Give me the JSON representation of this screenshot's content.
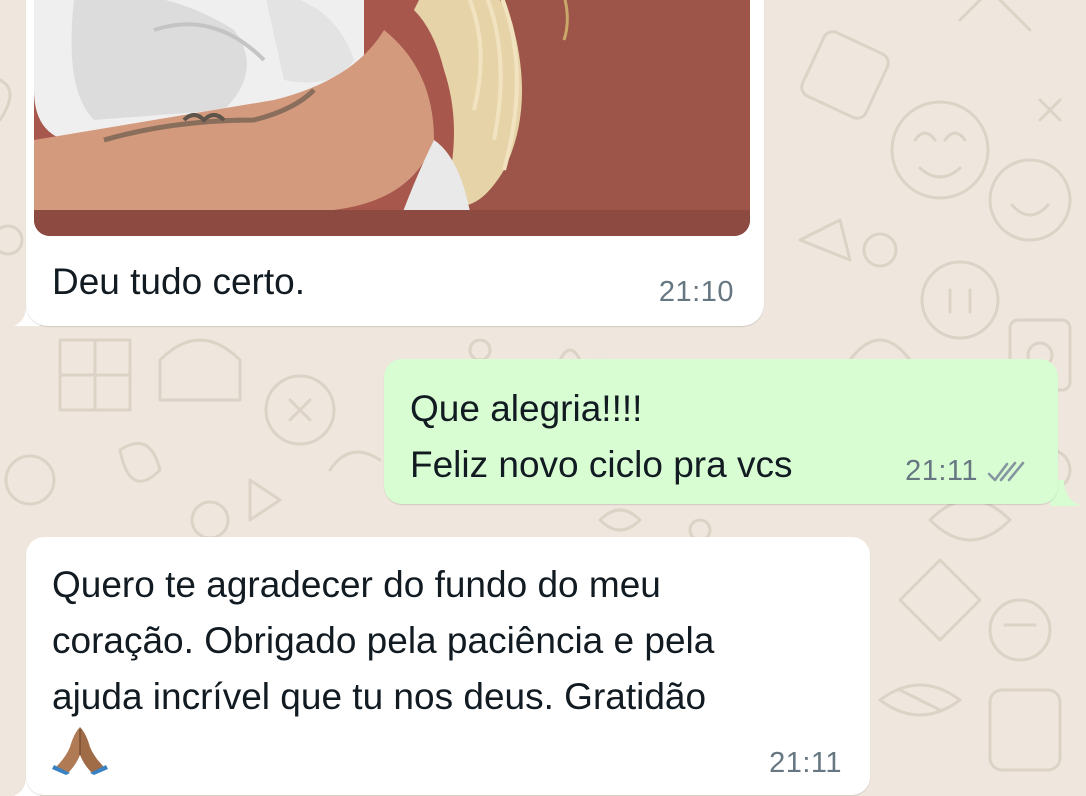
{
  "colors": {
    "wallpaper": "#efe7dd",
    "incoming_bubble": "#ffffff",
    "outgoing_bubble": "#d9fdd3",
    "text": "#111b21",
    "timestamp": "#667781",
    "read_ticks": "#8696a0"
  },
  "messages": [
    {
      "direction": "incoming",
      "type": "image",
      "caption": "Deu tudo certo.",
      "time": "21:10"
    },
    {
      "direction": "outgoing",
      "type": "text",
      "lines": [
        "Que alegria!!!!",
        "Feliz novo ciclo pra vcs"
      ],
      "time": "21:11",
      "status_icon": "double-check-icon"
    },
    {
      "direction": "incoming",
      "type": "text",
      "lines": [
        "Quero te agradecer do fundo do meu",
        "coração. Obrigado pela paciência e pela",
        "ajuda incrível que tu nos deus. Gratidão"
      ],
      "emoji": "🙏🏽",
      "time": "21:11"
    }
  ]
}
